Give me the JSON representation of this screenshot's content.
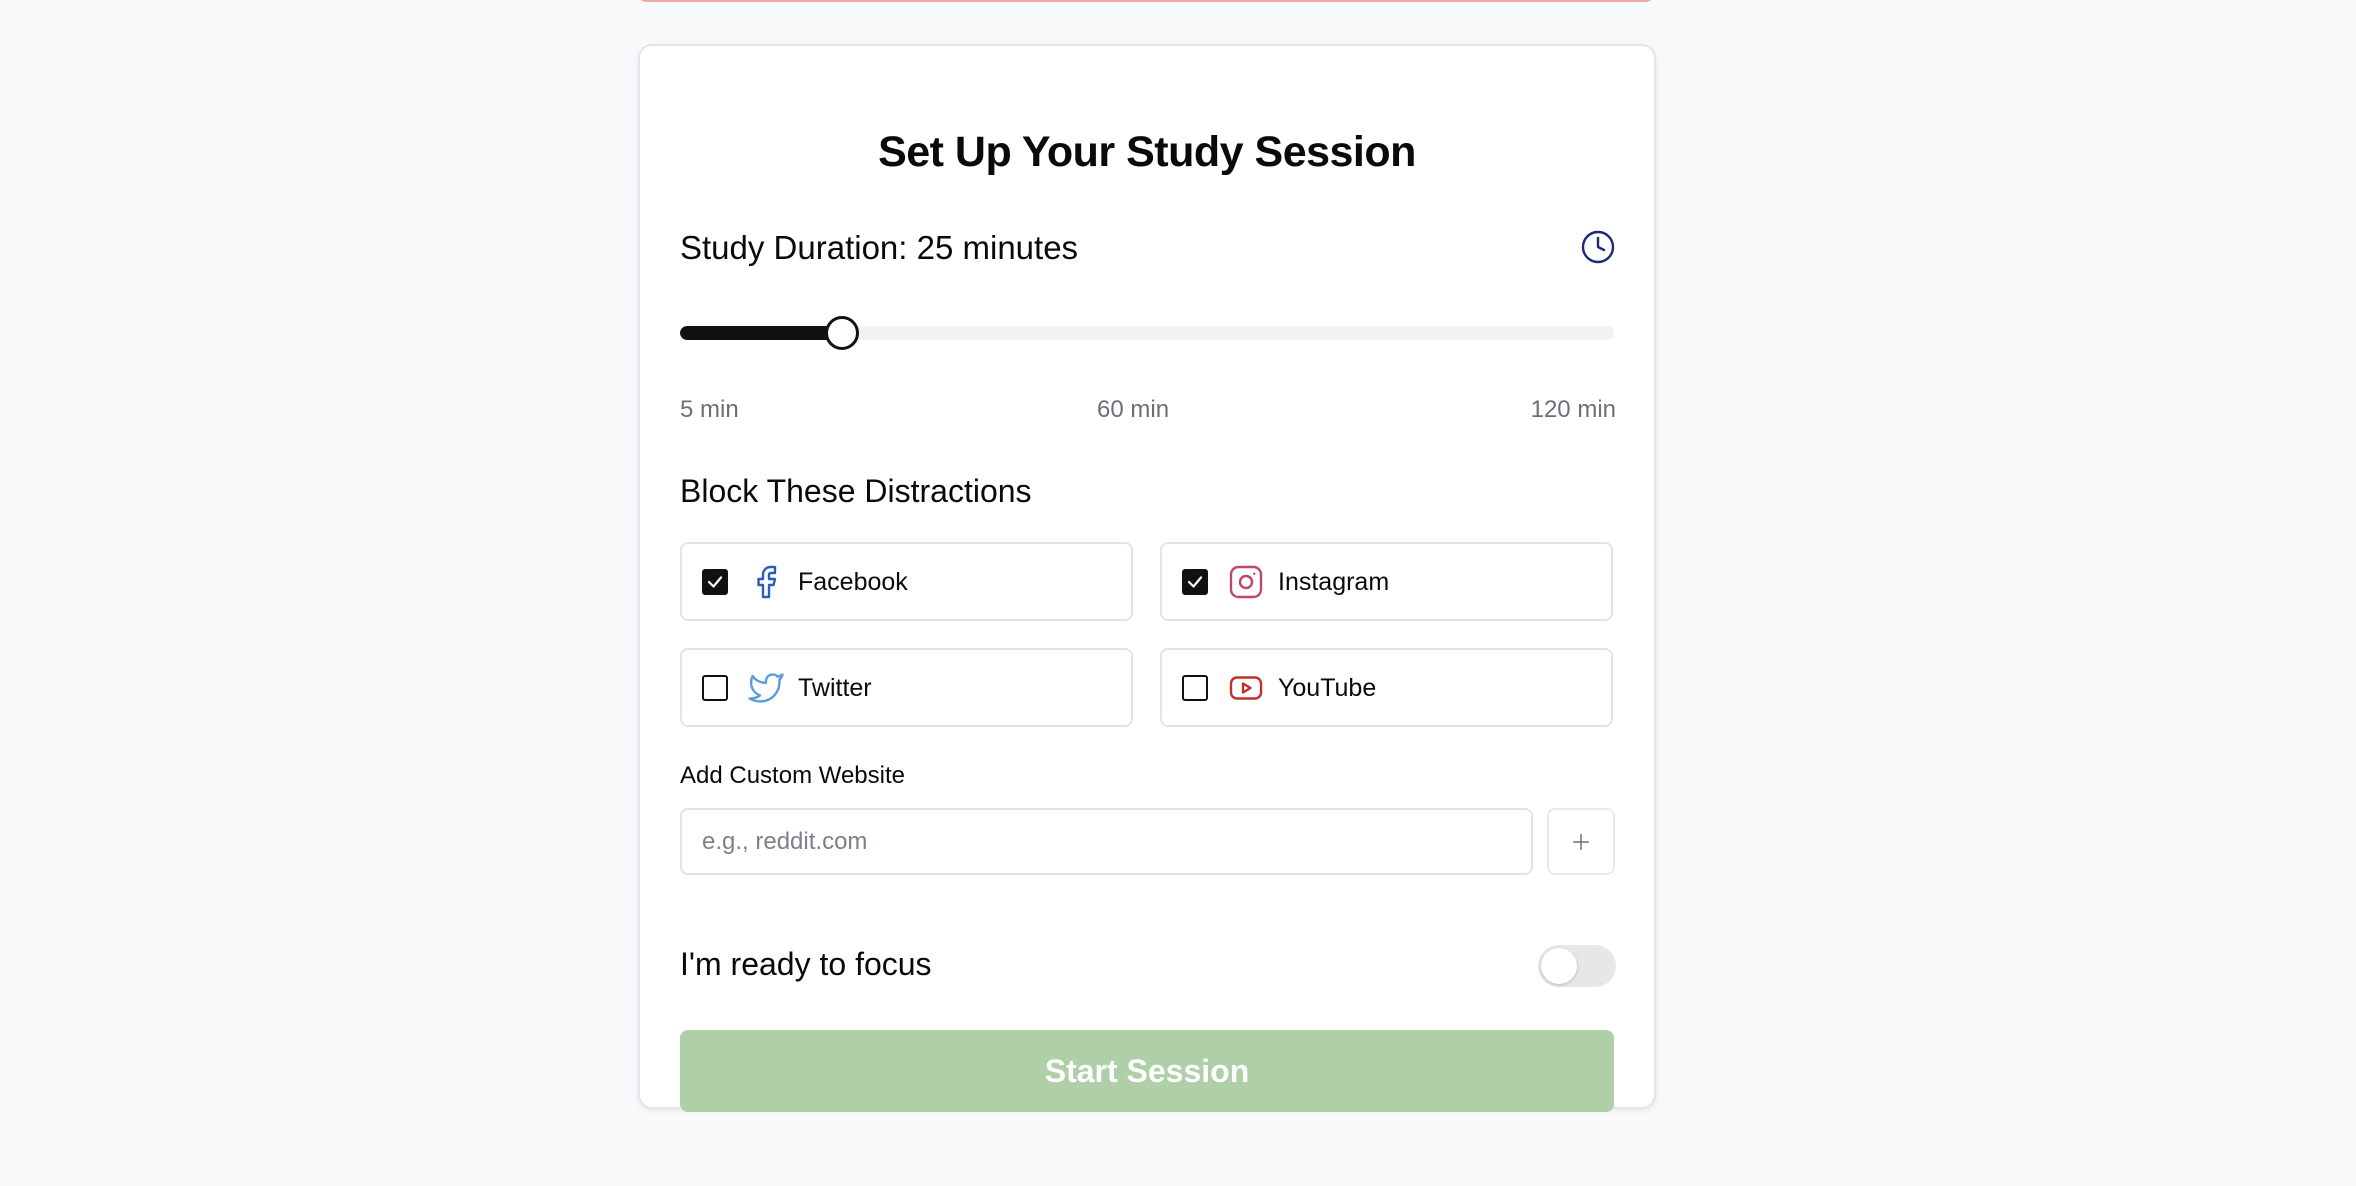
{
  "page": {
    "title": "Set Up Your Study Session"
  },
  "duration": {
    "label": "Study Duration: 25 minutes",
    "value_minutes": 25,
    "min_minutes": 5,
    "max_minutes": 120,
    "min_label": "5 min",
    "mid_label": "60 min",
    "max_label": "120 min"
  },
  "distractions": {
    "title": "Block These Distractions",
    "sites": [
      {
        "label": "Facebook",
        "checked": true,
        "icon": "facebook-icon",
        "color": "#2b5cb8"
      },
      {
        "label": "Instagram",
        "checked": true,
        "icon": "instagram-icon",
        "color": "#c0466e"
      },
      {
        "label": "Twitter",
        "checked": false,
        "icon": "twitter-icon",
        "color": "#5a9be0"
      },
      {
        "label": "YouTube",
        "checked": false,
        "icon": "youtube-icon",
        "color": "#c0302f"
      }
    ]
  },
  "custom_site": {
    "label": "Add Custom Website",
    "value": "",
    "placeholder": "e.g., reddit.com",
    "add_icon": "plus-icon"
  },
  "ready": {
    "label": "I'm ready to focus",
    "enabled": false
  },
  "start_button": {
    "label": "Start Session",
    "disabled": true,
    "color": "#aecfa8"
  },
  "colors": {
    "accent": "#111111",
    "clock_icon": "#1e2a78",
    "muted_text": "#6b6f76"
  }
}
